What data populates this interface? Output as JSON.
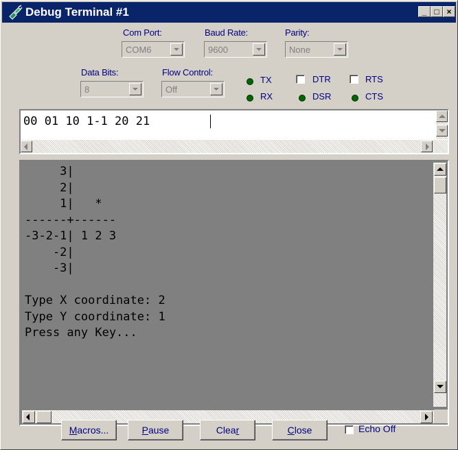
{
  "window": {
    "title": "Debug Terminal #1"
  },
  "titlebar_buttons": {
    "minimize": "_",
    "maximize": "□",
    "close": "×"
  },
  "settings": {
    "com_port": {
      "label": "Com Port:",
      "value": "COM6"
    },
    "baud_rate": {
      "label": "Baud Rate:",
      "value": "9600"
    },
    "parity": {
      "label": "Parity:",
      "value": "None"
    },
    "data_bits": {
      "label": "Data Bits:",
      "value": "8"
    },
    "flow_control": {
      "label": "Flow Control:",
      "value": "Off"
    }
  },
  "indicators": {
    "tx": "TX",
    "rx": "RX",
    "dtr": "DTR",
    "rts": "RTS",
    "dsr": "DSR",
    "cts": "CTS",
    "led_color": "#006400"
  },
  "input": {
    "value": "00 01 10 1-1 20 21"
  },
  "terminal": {
    "background": "#808080",
    "lines": [
      "     3|",
      "     2|",
      "     1|   *",
      "------+------",
      "-3-2-1| 1 2 3",
      "    -2|",
      "    -3|",
      "",
      "Type X coordinate: 2",
      "Type Y coordinate: 1",
      "Press any Key..."
    ]
  },
  "buttons": {
    "macros": {
      "key": "M",
      "rest": "acros..."
    },
    "pause": {
      "key": "P",
      "rest": "ause"
    },
    "clear": {
      "pre": "Clea",
      "key": "r"
    },
    "close": {
      "key": "C",
      "rest": "lose"
    },
    "echo_off": "Echo Off"
  },
  "icons": {
    "app": "terminal-plug-icon"
  }
}
